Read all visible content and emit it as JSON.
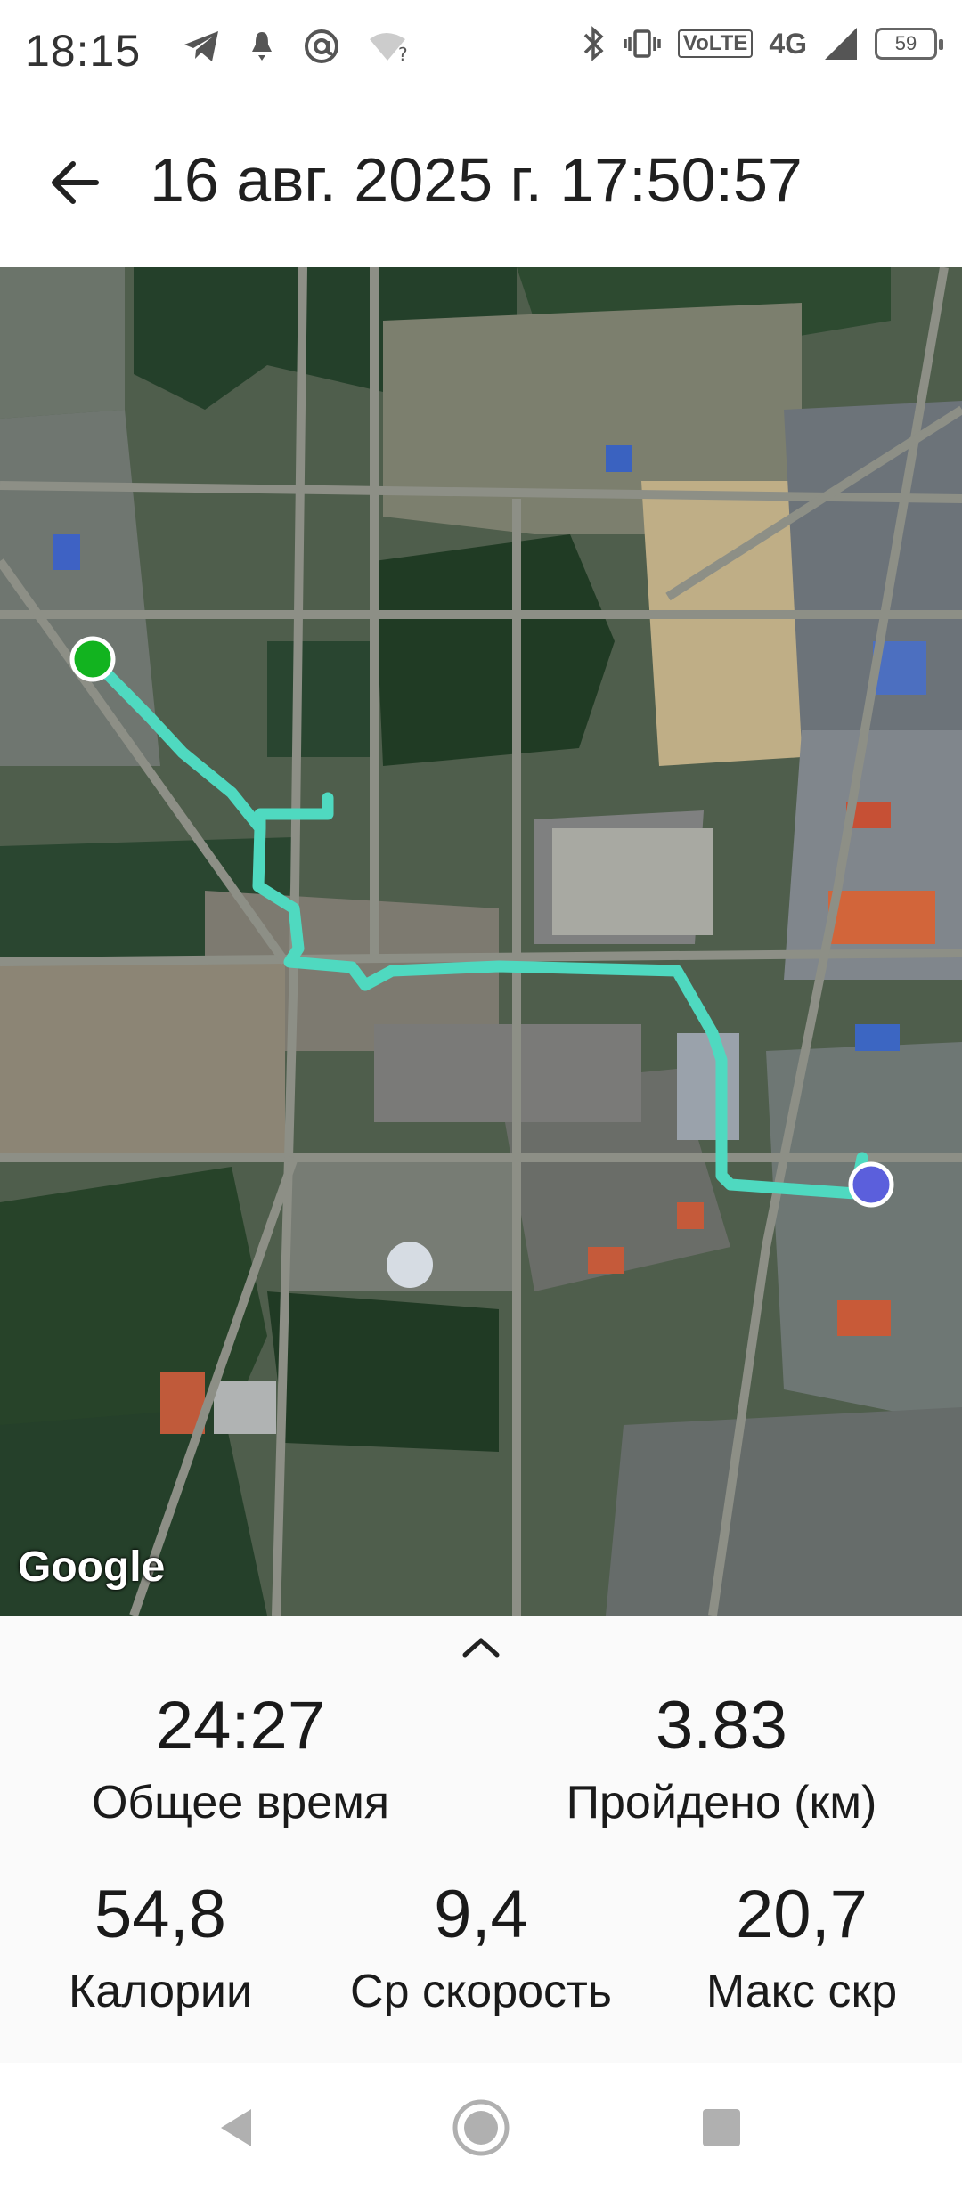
{
  "status_bar": {
    "time": "18:15",
    "left_icons": [
      "telegram-icon",
      "notification-icon",
      "at-sign-icon",
      "wifi-question-icon"
    ],
    "right_icons": [
      "bluetooth-icon",
      "vibrate-icon",
      "volte-badge",
      "network-4g",
      "signal-icon",
      "battery-icon"
    ],
    "volte": "VoLTE",
    "network": "4G",
    "battery": "59"
  },
  "app_bar": {
    "title": "16 авг. 2025 г. 17:50:57",
    "back_icon": "arrow-back-icon"
  },
  "map": {
    "attribution": "Google",
    "route_color": "#4fd9c0",
    "start_marker_color": "#12b31f",
    "end_marker_color": "#5b5fdc"
  },
  "stats": {
    "expand_icon": "chevron-up-icon",
    "total_time": {
      "value": "24:27",
      "label": "Общее время"
    },
    "distance": {
      "value": "3.83",
      "label": "Пройдено (км)"
    },
    "calories": {
      "value": "54,8",
      "label": "Калории"
    },
    "avg_speed": {
      "value": "9,4",
      "label": "Ср скорость"
    },
    "max_speed": {
      "value": "20,7",
      "label": "Макс скр"
    }
  },
  "nav_bar": {
    "buttons": [
      "back-triangle-icon",
      "home-circle-icon",
      "recents-square-icon"
    ]
  }
}
